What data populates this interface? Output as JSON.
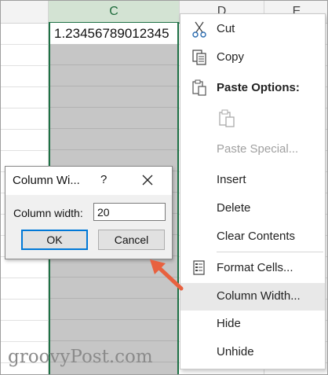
{
  "sheet": {
    "columns": [
      "C",
      "D",
      "E"
    ],
    "active_cell_value": "1.23456789012345"
  },
  "context_menu": {
    "items": [
      {
        "label": "Cut",
        "icon": "scissors-icon"
      },
      {
        "label": "Copy",
        "icon": "copy-icon"
      },
      {
        "label": "Paste Options:",
        "icon": "paste-icon"
      },
      {
        "label": "Paste Special...",
        "icon": ""
      },
      {
        "label": "Insert",
        "icon": ""
      },
      {
        "label": "Delete",
        "icon": ""
      },
      {
        "label": "Clear Contents",
        "icon": ""
      },
      {
        "label": "Format Cells...",
        "icon": "format-cells-icon"
      },
      {
        "label": "Column Width...",
        "icon": ""
      },
      {
        "label": "Hide",
        "icon": ""
      },
      {
        "label": "Unhide",
        "icon": ""
      }
    ]
  },
  "dialog": {
    "title": "Column Wi...",
    "help": "?",
    "field_label": "Column width:",
    "field_value": "20",
    "ok_label": "OK",
    "cancel_label": "Cancel"
  },
  "watermark": "groovyPost.com",
  "colors": {
    "selection_green": "#1e7145",
    "selected_fill": "#c6c6c6",
    "arrow": "#e8613f",
    "focus_blue": "#0078d7"
  }
}
